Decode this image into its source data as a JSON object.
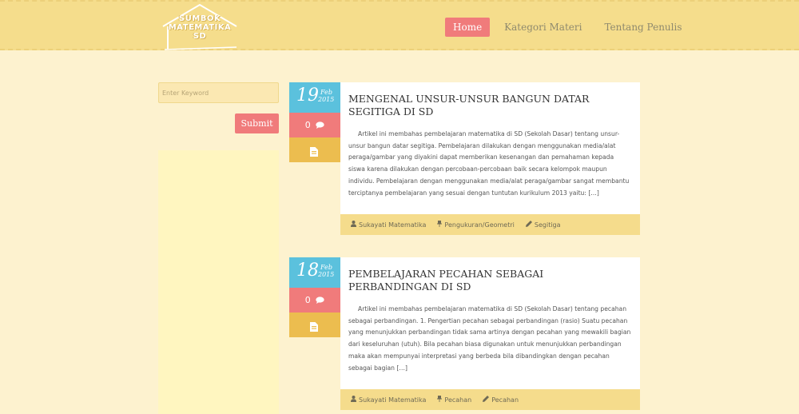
{
  "site": {
    "logo_lines": [
      "SUMBOK",
      "MATEMATIKA",
      "SD"
    ]
  },
  "nav": {
    "items": [
      {
        "label": "Home",
        "active": true
      },
      {
        "label": "Kategori Materi",
        "active": false
      },
      {
        "label": "Tentang Penulis",
        "active": false
      }
    ]
  },
  "sidebar": {
    "search_placeholder": "Enter Keyword",
    "submit_label": "Submit"
  },
  "colors": {
    "accent_red": "#f07b7b",
    "accent_blue": "#5bc1dd",
    "accent_gold": "#ecbd4f",
    "header_bg": "#f5dd8c",
    "page_bg": "#fdf2cf"
  },
  "posts": [
    {
      "day": "19",
      "month": "Feb",
      "year": "2015",
      "comments": "0",
      "title": "MENGENAL UNSUR-UNSUR BANGUN DATAR SEGITIGA DI SD",
      "excerpt": "Artikel ini membahas pembelajaran  matematika di SD (Sekolah Dasar) tentang unsur-unsur bangun  datar segitiga. Pembelajaran dilakukan dengan menggunakan media/alat peraga/gambar  yang diyakini dapat memberikan kesenangan dan pemahaman kepada siswa karena dilakukan dengan percobaan-percobaan baik secara kelompok maupun individu. Pembelajaran dengan menggunakan  media/alat peraga/gambar sangat membantu terciptanya pembelajaran yang sesuai dengan tuntutan kurikulum 2013 yaitu: […]",
      "author": "Sukayati Matematika",
      "category": "Pengukuran/Geometri",
      "tag": "Segitiga"
    },
    {
      "day": "18",
      "month": "Feb",
      "year": "2015",
      "comments": "0",
      "title": "PEMBELAJARAN PECAHAN SEBAGAI PERBANDINGAN DI SD",
      "excerpt": "Artikel ini membahas pembelajaran  matematika di SD (Sekolah Dasar) tentang  pecahan sebagai perbandingan. 1. Pengertian pecahan sebagai perbandingan (rasio)  Suatu pecahan yang menunjukkan perbandingan tidak sama artinya dengan pecahan yang mewakili bagian dari keseluruhan (utuh). Bila pecahan biasa digunakan untuk menunjukkan perbandingan maka akan mempunyai interpretasi yang berbeda bila dibandingkan dengan pecahan sebagai bagian […]",
      "author": "Sukayati Matematika",
      "category": "Pecahan",
      "tag": "Pecahan"
    }
  ],
  "icons": {
    "comment": "comment-icon",
    "doc": "document-icon",
    "author": "user-icon",
    "category": "pin-icon",
    "tag": "pencil-icon"
  }
}
